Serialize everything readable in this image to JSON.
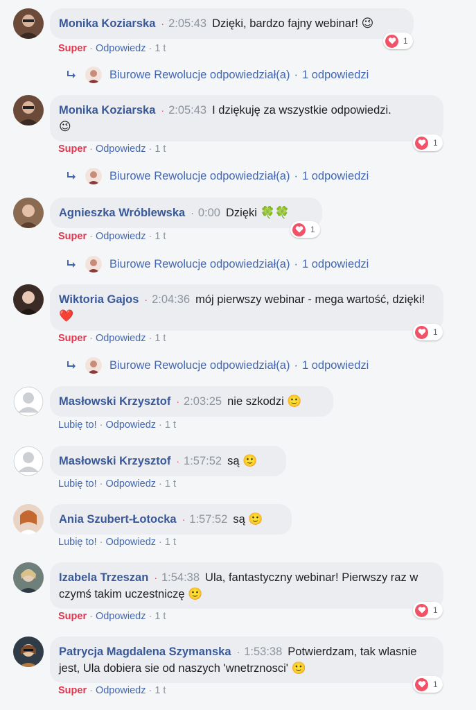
{
  "colors": {
    "author": "#385898",
    "link": "#4267b2",
    "super": "#e0364f",
    "heart": "#f25268",
    "bubble": "#ebedf0"
  },
  "comments": [
    {
      "author": "Monika Koziarska",
      "time": "2:05:43",
      "text": "Dzięki, bardzo fajny webinar!",
      "emoji": "😉",
      "reactions": "1",
      "reaction_label": "Super",
      "reply_label": "Odpowiedz",
      "age": "1 t",
      "replies": {
        "name": "Biurowe Rewolucje odpowiedział(a)",
        "count": "1 odpowiedzi"
      }
    },
    {
      "author": "Monika Koziarska",
      "time": "2:05:43",
      "text": "I dziękuję za wszystkie odpowiedzi.",
      "emoji": "😉",
      "reactions": "1",
      "reaction_label": "Super",
      "reply_label": "Odpowiedz",
      "age": "1 t",
      "replies": {
        "name": "Biurowe Rewolucje odpowiedział(a)",
        "count": "1 odpowiedzi"
      }
    },
    {
      "author": "Agnieszka Wróblewska",
      "time": "0:00",
      "text": "Dzięki",
      "emoji": "🍀🍀",
      "reactions": "1",
      "reaction_label": "Super",
      "reply_label": "Odpowiedz",
      "age": "1 t",
      "replies": {
        "name": "Biurowe Rewolucje odpowiedział(a)",
        "count": "1 odpowiedzi"
      }
    },
    {
      "author": "Wiktoria Gajos",
      "time": "2:04:36",
      "text": "mój pierwszy webinar - mega wartość, dzięki!",
      "emoji": "❤️",
      "reactions": "1",
      "reaction_label": "Super",
      "reply_label": "Odpowiedz",
      "age": "1 t",
      "replies": {
        "name": "Biurowe Rewolucje odpowiedział(a)",
        "count": "1 odpowiedzi"
      }
    },
    {
      "author": "Masłowski Krzysztof",
      "time": "2:03:25",
      "text": "nie szkodzi",
      "emoji": "🙂",
      "reaction_label": "Lubię to!",
      "reply_label": "Odpowiedz",
      "age": "1 t"
    },
    {
      "author": "Masłowski Krzysztof",
      "time": "1:57:52",
      "text": "są",
      "emoji": "🙂",
      "reaction_label": "Lubię to!",
      "reply_label": "Odpowiedz",
      "age": "1 t"
    },
    {
      "author": "Ania Szubert-Łotocka",
      "time": "1:57:52",
      "text": "są",
      "emoji": "🙂",
      "reaction_label": "Lubię to!",
      "reply_label": "Odpowiedz",
      "age": "1 t"
    },
    {
      "author": "Izabela Trzeszan",
      "time": "1:54:38",
      "text": "Ula, fantastyczny webinar! Pierwszy raz w czymś takim uczestniczę",
      "emoji": "🙂",
      "reactions": "1",
      "reaction_label": "Super",
      "reply_label": "Odpowiedz",
      "age": "1 t"
    },
    {
      "author": "Patrycja Magdalena Szymanska",
      "time": "1:53:38",
      "text": "Potwierdzam, tak wlasnie jest, Ula dobiera sie od naszych 'wnetrznosci'",
      "emoji": "🙂",
      "reactions": "1",
      "reaction_label": "Super",
      "reply_label": "Odpowiedz",
      "age": "1 t"
    }
  ]
}
